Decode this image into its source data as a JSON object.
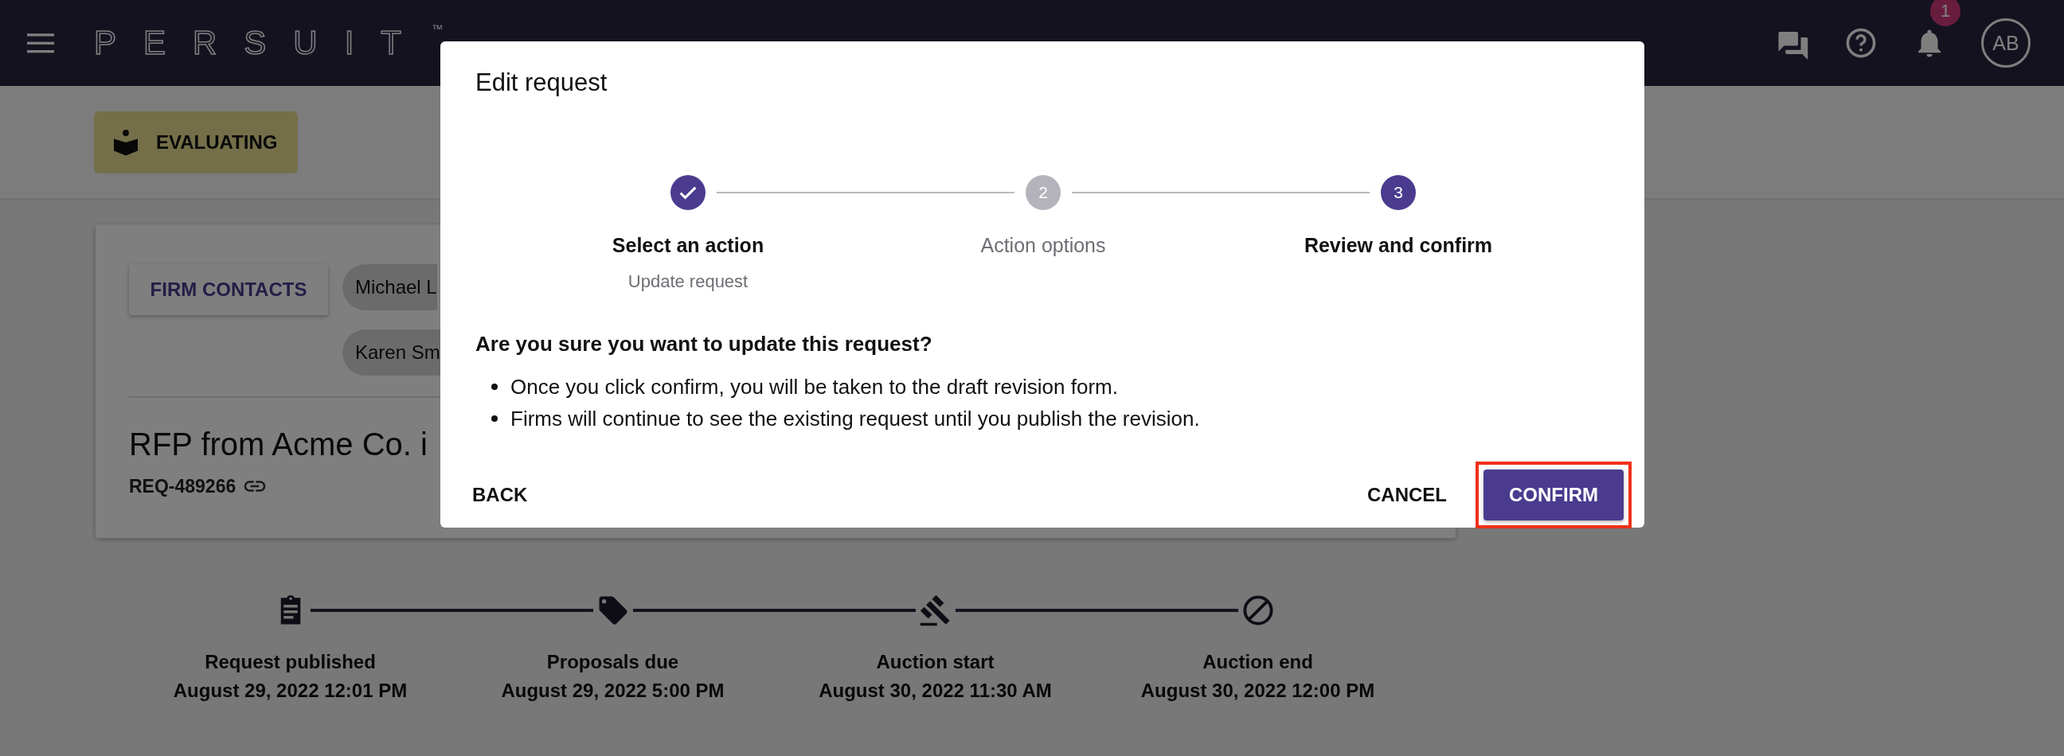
{
  "header": {
    "brand": "PERSUIT",
    "trademark": "™",
    "notification_count": "1",
    "avatar_initials": "AB"
  },
  "status": {
    "label": "EVALUATING"
  },
  "request_card": {
    "contacts_button": "FIRM CONTACTS",
    "contacts": [
      "Michael L",
      "Karen Sm"
    ],
    "title": "RFP from Acme Co. i",
    "reference": "REQ-489266"
  },
  "timeline": [
    {
      "label": "Request published",
      "date": "August 29, 2022 12:01 PM"
    },
    {
      "label": "Proposals due",
      "date": "August 29, 2022 5:00 PM"
    },
    {
      "label": "Auction start",
      "date": "August 30, 2022 11:30 AM"
    },
    {
      "label": "Auction end",
      "date": "August 30, 2022 12:00 PM"
    }
  ],
  "dialog": {
    "title": "Edit request",
    "steps": [
      {
        "title": "Select an action",
        "subtitle": "Update request",
        "completed": true,
        "selected": false
      },
      {
        "number": "2",
        "title": "Action options",
        "completed": false,
        "selected": false
      },
      {
        "number": "3",
        "title": "Review and confirm",
        "completed": false,
        "selected": true
      }
    ],
    "question": "Are you sure you want to update this request?",
    "bullets": [
      "Once you click confirm, you will be taken to the draft revision form.",
      "Firms will continue to see the existing request until you publish the revision."
    ],
    "back_button": "BACK",
    "cancel_button": "CANCEL",
    "confirm_button": "CONFIRM",
    "confirm_highlighted": true
  }
}
